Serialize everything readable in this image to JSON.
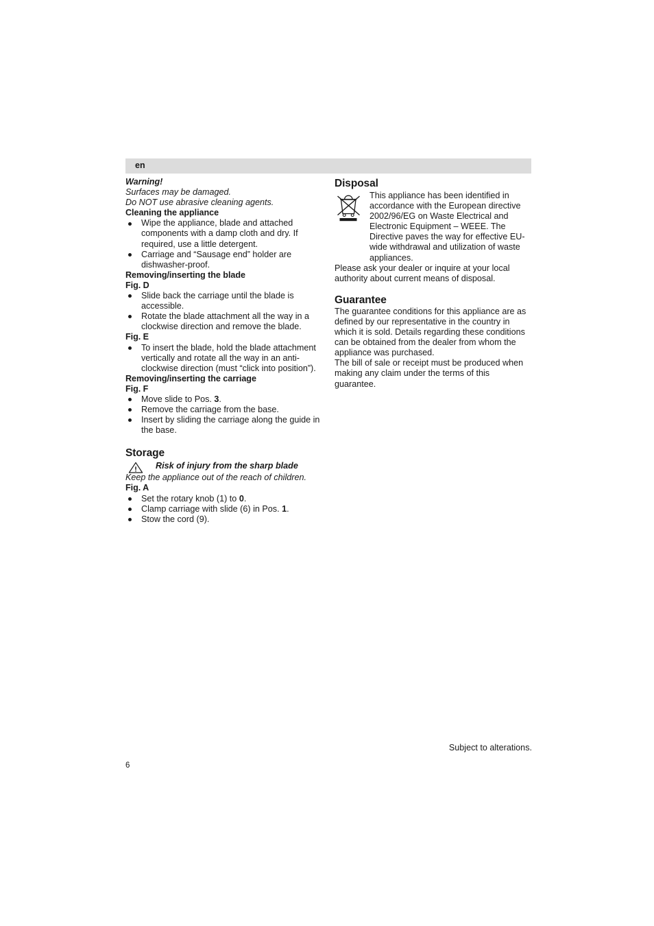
{
  "page": {
    "language_tab": "en",
    "page_number": "6",
    "footer_note": "Subject to alterations."
  },
  "left_column": {
    "warning": {
      "heading": "Warning!",
      "lines": [
        "Surfaces may be damaged.",
        "Do NOT use abrasive cleaning agents."
      ]
    },
    "cleaning": {
      "heading": "Cleaning the appliance",
      "bullets": [
        "Wipe the appliance, blade and attached components with a damp cloth and dry. If required, use a little detergent.",
        "Carriage and “Sausage end” holder are dishwasher-proof."
      ]
    },
    "blade": {
      "heading": "Removing/inserting the blade",
      "fig_d_label": "Fig. D",
      "fig_d_bullets": [
        "Slide back the carriage until the blade is accessible.",
        "Rotate the blade attachment all the way in a clockwise direction and remove the blade."
      ],
      "fig_e_label": "Fig. E",
      "fig_e_bullets": [
        "To insert the blade, hold the blade attachment vertically and rotate all the way in an anti-clockwise direction (must “click into position”)."
      ]
    },
    "carriage": {
      "heading": "Removing/inserting the carriage",
      "fig_f_label": "Fig. F",
      "fig_f_bullets": [
        {
          "pre": "Move slide to Pos. ",
          "bold": "3",
          "post": "."
        },
        {
          "pre": "Remove the carriage from the base.",
          "bold": "",
          "post": ""
        },
        {
          "pre": "Insert by sliding the carriage along the guide in the base.",
          "bold": "",
          "post": ""
        }
      ]
    },
    "storage": {
      "heading": "Storage",
      "risk_icon": "warning-triangle-icon",
      "risk_text": "Risk of injury from the sharp blade",
      "note": "Keep the appliance out of the reach of children.",
      "fig_a_label": "Fig. A",
      "fig_a_bullets": [
        {
          "pre": "Set the rotary knob (1) to ",
          "bold": "0",
          "post": "."
        },
        {
          "pre": "Clamp carriage with slide (6) in Pos. ",
          "bold": "1",
          "post": "."
        },
        {
          "pre": "Stow the cord (9).",
          "bold": "",
          "post": ""
        }
      ]
    }
  },
  "right_column": {
    "disposal": {
      "heading": "Disposal",
      "icon": "crossed-out-wheelie-bin-icon",
      "icon_paragraph": "This appliance has been identified in accordance with the European directive 2002/96/EG on Waste Electrical and Electronic Equipment – WEEE. The Directive paves the way for effective EU-wide withdrawal and utilization of waste appliances.",
      "paragraph": "Please ask your dealer or inquire at your local authority about current means of disposal."
    },
    "guarantee": {
      "heading": "Guarantee",
      "paragraphs": [
        "The guarantee conditions for this appliance are as defined by our representative in the country in which it is sold. Details regarding these conditions can be obtained from the dealer from whom the appliance was purchased.",
        "The bill of sale or receipt must be produced when making any claim under the terms of this guarantee."
      ]
    }
  },
  "colors": {
    "header_bar": "#dcdcdc",
    "text": "#1a1a1a",
    "background": "#ffffff"
  }
}
